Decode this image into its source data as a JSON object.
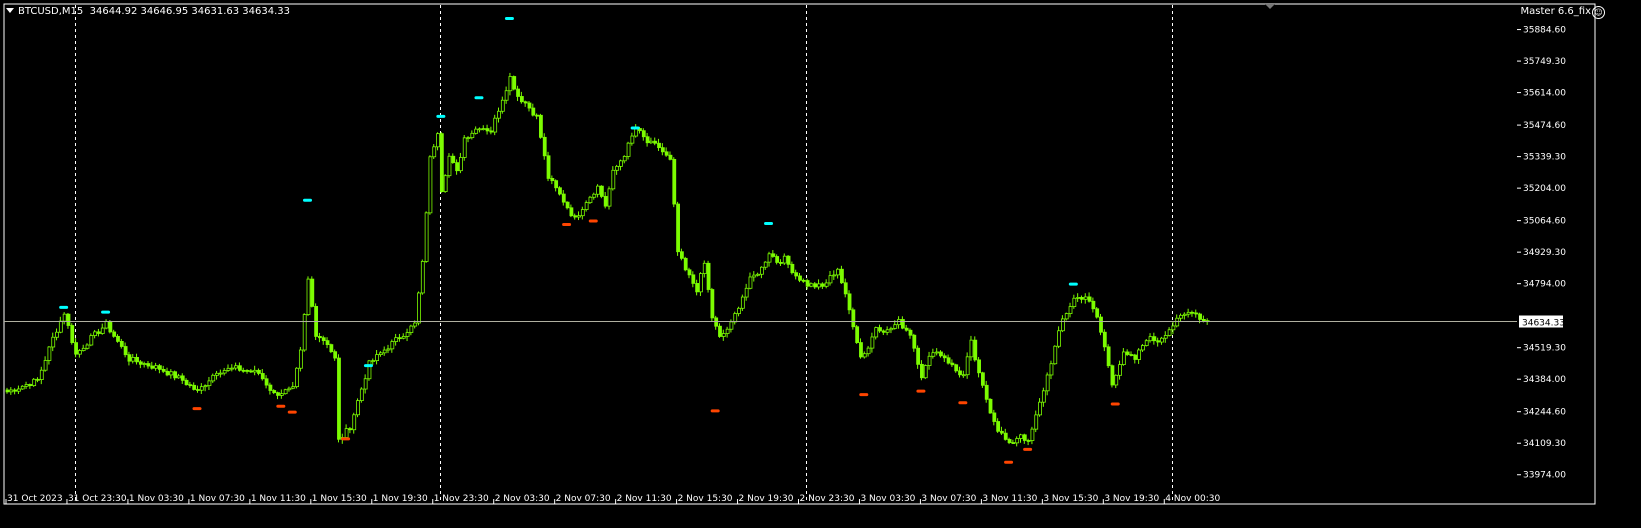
{
  "header": {
    "symbol": "BTCUSD,M15",
    "ohlc": "34644.92 34646.95 34631.63 34634.33",
    "ea_name": "Master 6.6_fix",
    "ea_icon": "smiley-icon"
  },
  "colors": {
    "background": "#000000",
    "candle": "#7CFC00",
    "frame": "#ffffff",
    "grid": "#ffffff",
    "fractal_up": "#00ffff",
    "fractal_down": "#ff4500",
    "bid_line": "#b0b0a0"
  },
  "chart_data": {
    "type": "candlestick",
    "current_price": 34634.33,
    "current_price_label": "34634.33",
    "ylim": [
      33930,
      35990
    ],
    "y_ticks": [
      "35884.60",
      "35749.30",
      "35614.00",
      "35474.60",
      "35339.30",
      "35204.00",
      "35064.60",
      "34929.30",
      "34794.00",
      "34519.30",
      "34384.00",
      "34244.60",
      "34109.30",
      "33974.00"
    ],
    "x_ticks": [
      "31 Oct 2023",
      "31 Oct 23:30",
      "1 Nov 03:30",
      "1 Nov 07:30",
      "1 Nov 11:30",
      "1 Nov 15:30",
      "1 Nov 19:30",
      "1 Nov 23:30",
      "2 Nov 03:30",
      "2 Nov 07:30",
      "2 Nov 11:30",
      "2 Nov 15:30",
      "2 Nov 19:30",
      "2 Nov 23:30",
      "3 Nov 03:30",
      "3 Nov 07:30",
      "3 Nov 11:30",
      "3 Nov 15:30",
      "3 Nov 19:30",
      "4 Nov 00:30"
    ],
    "x_tick_bars": [
      0,
      16,
      32,
      48,
      64,
      80,
      96,
      112,
      128,
      144,
      160,
      176,
      192,
      208,
      224,
      240,
      256,
      272,
      288,
      304
    ],
    "period_separators_bars": [
      18,
      114,
      210,
      306
    ],
    "key_points": [
      [
        0,
        34330
      ],
      [
        8,
        34380
      ],
      [
        12,
        34560
      ],
      [
        15,
        34670
      ],
      [
        18,
        34490
      ],
      [
        22,
        34560
      ],
      [
        26,
        34620
      ],
      [
        32,
        34470
      ],
      [
        40,
        34430
      ],
      [
        46,
        34380
      ],
      [
        50,
        34330
      ],
      [
        55,
        34420
      ],
      [
        60,
        34430
      ],
      [
        66,
        34410
      ],
      [
        70,
        34320
      ],
      [
        75,
        34340
      ],
      [
        77,
        34500
      ],
      [
        79,
        34810
      ],
      [
        81,
        34580
      ],
      [
        84,
        34540
      ],
      [
        86,
        34470
      ],
      [
        87,
        34120
      ],
      [
        90,
        34180
      ],
      [
        92,
        34290
      ],
      [
        95,
        34450
      ],
      [
        99,
        34510
      ],
      [
        104,
        34580
      ],
      [
        107,
        34620
      ],
      [
        109,
        34880
      ],
      [
        111,
        35330
      ],
      [
        113,
        35450
      ],
      [
        114,
        35200
      ],
      [
        116,
        35340
      ],
      [
        118,
        35270
      ],
      [
        120,
        35420
      ],
      [
        124,
        35470
      ],
      [
        127,
        35450
      ],
      [
        130,
        35590
      ],
      [
        132,
        35680
      ],
      [
        134,
        35600
      ],
      [
        136,
        35570
      ],
      [
        139,
        35510
      ],
      [
        142,
        35250
      ],
      [
        146,
        35150
      ],
      [
        149,
        35070
      ],
      [
        152,
        35150
      ],
      [
        155,
        35210
      ],
      [
        157,
        35130
      ],
      [
        159,
        35270
      ],
      [
        162,
        35350
      ],
      [
        165,
        35460
      ],
      [
        168,
        35400
      ],
      [
        171,
        35380
      ],
      [
        174,
        35320
      ],
      [
        176,
        34930
      ],
      [
        178,
        34850
      ],
      [
        181,
        34770
      ],
      [
        183,
        34880
      ],
      [
        185,
        34650
      ],
      [
        187,
        34560
      ],
      [
        190,
        34620
      ],
      [
        193,
        34740
      ],
      [
        195,
        34810
      ],
      [
        198,
        34860
      ],
      [
        200,
        34930
      ],
      [
        202,
        34890
      ],
      [
        204,
        34900
      ],
      [
        207,
        34830
      ],
      [
        210,
        34790
      ],
      [
        214,
        34780
      ],
      [
        218,
        34860
      ],
      [
        222,
        34620
      ],
      [
        224,
        34480
      ],
      [
        226,
        34520
      ],
      [
        228,
        34610
      ],
      [
        231,
        34590
      ],
      [
        234,
        34630
      ],
      [
        237,
        34580
      ],
      [
        240,
        34400
      ],
      [
        243,
        34510
      ],
      [
        246,
        34480
      ],
      [
        249,
        34420
      ],
      [
        251,
        34400
      ],
      [
        253,
        34540
      ],
      [
        255,
        34400
      ],
      [
        258,
        34250
      ],
      [
        260,
        34170
      ],
      [
        263,
        34100
      ],
      [
        266,
        34150
      ],
      [
        268,
        34110
      ],
      [
        271,
        34280
      ],
      [
        274,
        34460
      ],
      [
        277,
        34640
      ],
      [
        280,
        34730
      ],
      [
        283,
        34740
      ],
      [
        286,
        34650
      ],
      [
        288,
        34520
      ],
      [
        290,
        34370
      ],
      [
        293,
        34490
      ],
      [
        296,
        34470
      ],
      [
        299,
        34560
      ],
      [
        302,
        34550
      ],
      [
        305,
        34600
      ],
      [
        308,
        34650
      ],
      [
        311,
        34680
      ],
      [
        314,
        34634.33
      ]
    ],
    "fractals_up": [
      [
        15,
        34690
      ],
      [
        26,
        34670
      ],
      [
        79,
        35150
      ],
      [
        95,
        34440
      ],
      [
        114,
        35510
      ],
      [
        124,
        35590
      ],
      [
        132,
        35930
      ],
      [
        165,
        35460
      ],
      [
        200,
        35050
      ],
      [
        280,
        34790
      ]
    ],
    "fractals_down": [
      [
        50,
        34260
      ],
      [
        72,
        34270
      ],
      [
        75,
        34245
      ],
      [
        89,
        34130
      ],
      [
        186,
        34250
      ],
      [
        225,
        34320
      ],
      [
        240,
        34335
      ],
      [
        251,
        34285
      ],
      [
        263,
        34030
      ],
      [
        268,
        34085
      ],
      [
        147,
        35050
      ],
      [
        154,
        35065
      ],
      [
        291,
        34280
      ]
    ]
  }
}
